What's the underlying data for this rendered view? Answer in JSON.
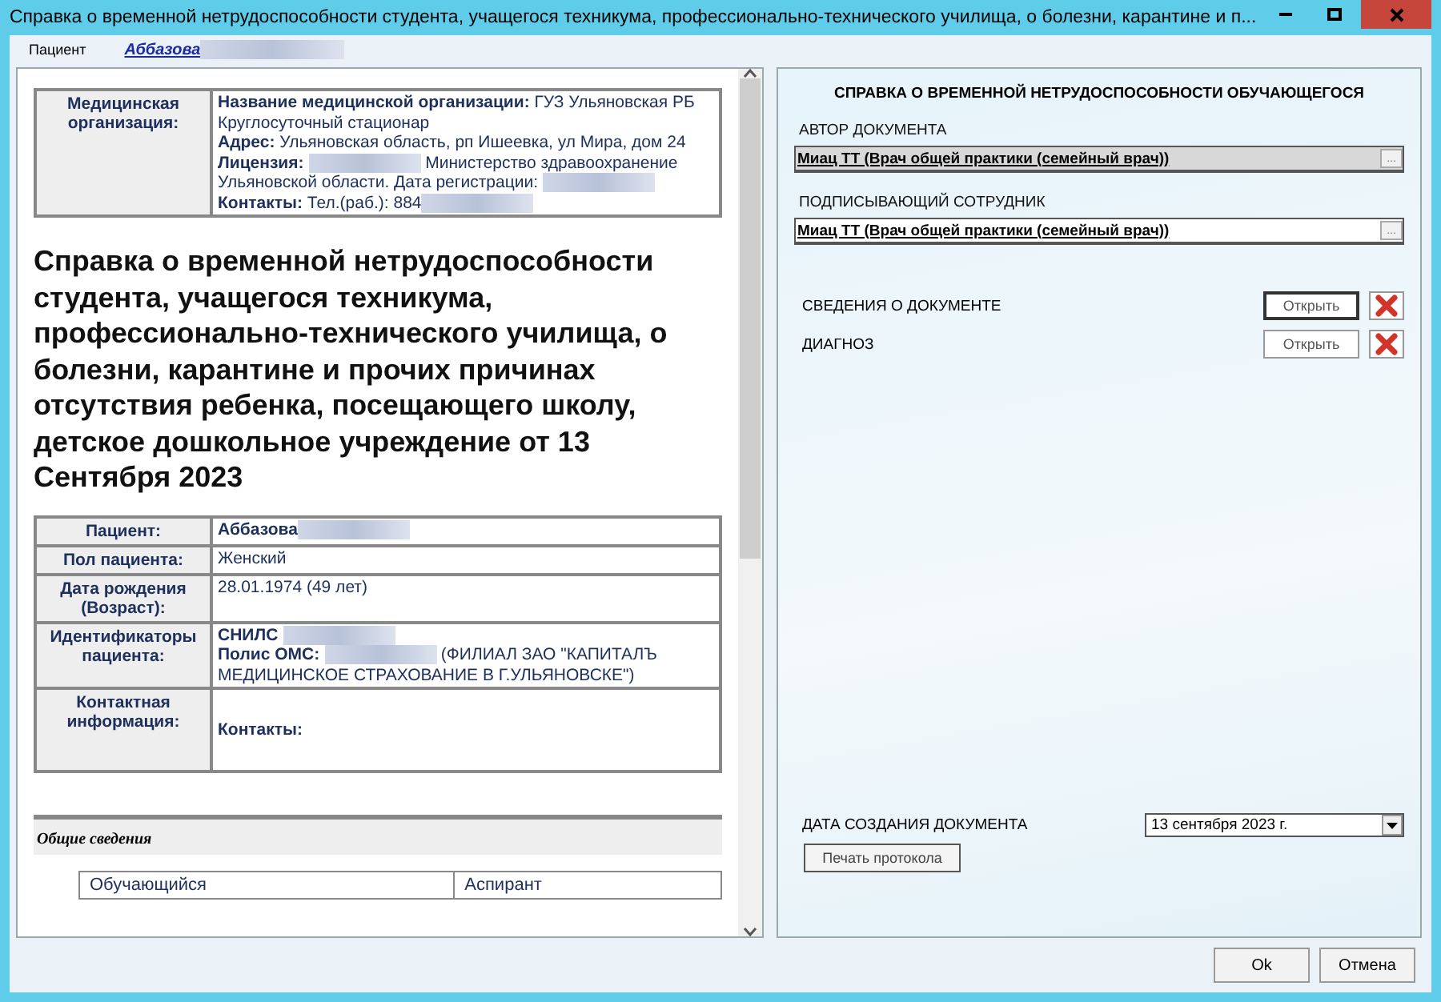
{
  "window": {
    "title": "Справка о временной нетрудоспособности студента, учащегося техникума, профессионально-технического училища, о болезни, карантине и п..."
  },
  "patient_bar": {
    "label": "Пациент",
    "patient_link": "Аббазова"
  },
  "document": {
    "org_table": {
      "label": "Медицинская организация:",
      "lines": [
        [
          {
            "kind": "text",
            "text": "**Название медицинской организации:** ГУЗ Ульяновская РБ Круглосуточный стационар"
          }
        ],
        [
          {
            "kind": "text",
            "text": "**Адрес:** Ульяновская область, рп Ишеевка, ул Мира, дом 24"
          }
        ],
        [
          {
            "kind": "text",
            "text": "**Лицензия:** "
          },
          {
            "kind": "redacted"
          },
          {
            "kind": "text",
            "text": " Министерство здравоохранение Ульяновской области. Дата регистрации: "
          },
          {
            "kind": "redacted"
          }
        ],
        [
          {
            "kind": "text",
            "text": "**Контакты:** Тел.(раб.): 884"
          },
          {
            "kind": "redacted"
          }
        ]
      ]
    },
    "heading": "Справка о временной нетрудоспособности студента, учащегося техникума, профессионально-технического училища, о болезни, карантине и прочих причинах отсутствия ребенка, посещающего школу, детское дошкольное учреждение от 13 Сентября 2023",
    "patient_table": [
      {
        "label": "Пациент:",
        "lines": [
          [
            {
              "kind": "text",
              "text": "**Аббазова**"
            },
            {
              "kind": "redacted"
            }
          ]
        ]
      },
      {
        "label": "Пол пациента:",
        "lines": [
          [
            {
              "kind": "text",
              "text": "Женский"
            }
          ]
        ]
      },
      {
        "label": "Дата рождения (Возраст):",
        "lines": [
          [
            {
              "kind": "text",
              "text": "28.01.1974 (49 лет)"
            }
          ]
        ]
      },
      {
        "label": "Идентификаторы пациента:",
        "lines": [
          [
            {
              "kind": "text",
              "text": "**СНИЛС** "
            },
            {
              "kind": "redacted"
            }
          ],
          [
            {
              "kind": "text",
              "text": "**Полис ОМС:** "
            },
            {
              "kind": "redacted"
            },
            {
              "kind": "text",
              "text": " (ФИЛИАЛ ЗАО \"КАПИТАЛЪ МЕДИЦИНСКОЕ СТРАХОВАНИЕ В Г.УЛЬЯНОВСКЕ\")"
            }
          ]
        ]
      },
      {
        "label": "Контактная информация:",
        "lines": [
          [
            {
              "kind": "text",
              "text": "**Контакты:**"
            }
          ]
        ]
      }
    ],
    "section_title": "Общие сведения",
    "info_table": [
      [
        "Обучающийся",
        "Аспирант"
      ]
    ]
  },
  "form": {
    "title": "СПРАВКА О ВРЕМЕННОЙ НЕТРУДОСПОСОБНОСТИ ОБУЧАЮЩЕГОСЯ",
    "fields": [
      {
        "label": "АВТОР ДОКУМЕНТА",
        "value": "Миац ТТ (Врач общей практики (семейный врач))",
        "disabled": true,
        "button": "..."
      },
      {
        "label": "ПОДПИСЫВАЮЩИЙ СОТРУДНИК",
        "value": "Миац ТТ (Врач общей практики (семейный врач))",
        "disabled": false,
        "button": "..."
      }
    ],
    "sections": [
      {
        "label": "СВЕДЕНИЯ О ДОКУМЕНТЕ",
        "button": "Открыть",
        "focused": true
      },
      {
        "label": "ДИАГНОЗ",
        "button": "Открыть",
        "focused": false
      }
    ],
    "date_label": "ДАТА СОЗДАНИЯ ДОКУМЕНТА",
    "date_value": "13 сентября 2023 г.",
    "print_button": "Печать протокола"
  },
  "buttons": [
    "Ok",
    "Отмена"
  ]
}
